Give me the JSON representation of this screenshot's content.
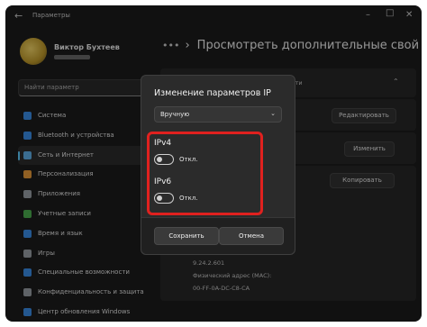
{
  "window": {
    "title": "Параметры",
    "back_icon": "back-arrow-icon"
  },
  "user": {
    "name": "Виктор Бухтеев"
  },
  "search": {
    "placeholder": "Найти параметр"
  },
  "sidebar": {
    "items": [
      {
        "label": "Система",
        "icon": "monitor-icon",
        "color": "#3b8ee8"
      },
      {
        "label": "Bluetooth и устройства",
        "icon": "bluetooth-icon",
        "color": "#3b8ee8"
      },
      {
        "label": "Сеть и Интернет",
        "icon": "network-icon",
        "color": "#5fb0e8"
      },
      {
        "label": "Персонализация",
        "icon": "brush-icon",
        "color": "#e89b3b"
      },
      {
        "label": "Приложения",
        "icon": "apps-icon",
        "color": "#9aa0a6"
      },
      {
        "label": "Учетные записи",
        "icon": "account-icon",
        "color": "#4caf50"
      },
      {
        "label": "Время и язык",
        "icon": "globe-icon",
        "color": "#3b8ee8"
      },
      {
        "label": "Игры",
        "icon": "gamepad-icon",
        "color": "#9aa0a6"
      },
      {
        "label": "Специальные возможности",
        "icon": "accessibility-icon",
        "color": "#3b8ee8"
      },
      {
        "label": "Конфиденциальность и защита",
        "icon": "shield-icon",
        "color": "#9aa0a6"
      },
      {
        "label": "Центр обновления Windows",
        "icon": "update-icon",
        "color": "#3b8ee8"
      }
    ],
    "active_index": 2
  },
  "header": {
    "breadcrumb": "Просмотреть дополнительные свой"
  },
  "background": {
    "section_suffix": "сети",
    "edit_label": "Редактировать",
    "change_label": "Изменить",
    "copy_label": "Копировать",
    "ip_value": "9.24.2.601",
    "mac_label": "Физический адрес (MAC):",
    "mac_value": "00-FF-0A-DC-C8-CA"
  },
  "dialog": {
    "title": "Изменение параметров IP",
    "mode": "Вручную",
    "ipv4": {
      "label": "IPv4",
      "state": "Откл."
    },
    "ipv6": {
      "label": "IPv6",
      "state": "Откл."
    },
    "save_label": "Сохранить",
    "cancel_label": "Отмена"
  },
  "colors": {
    "accent": "#60cdff",
    "highlight": "#e0211f"
  }
}
